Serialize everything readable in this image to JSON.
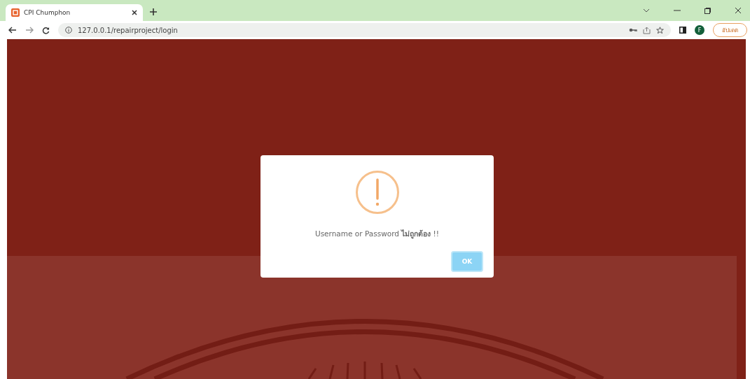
{
  "browser": {
    "tab": {
      "title": "CPI Chumphon",
      "selected": true
    },
    "address": "127.0.0.1/repairproject/login",
    "profile_initial": "F",
    "update_button": "อัปเดต"
  },
  "dialog": {
    "message": "Username or Password **ไม่ถูกต้อง** !!",
    "button": "OK"
  }
}
